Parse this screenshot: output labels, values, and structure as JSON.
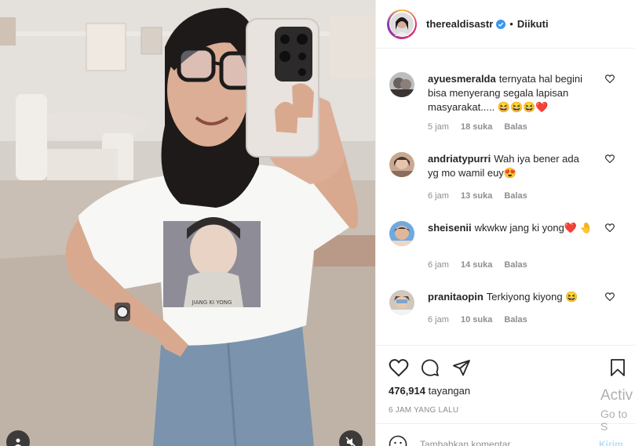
{
  "post": {
    "username": "therealdisastr",
    "follow_status": "Diikuti",
    "views_count": "476,914",
    "views_label": "tayangan",
    "time_ago": "6 JAM YANG LALU",
    "add_comment_placeholder": "Tambahkan komentar...",
    "post_label": "Kirim",
    "shirt_caption": "JIANG KI YONG"
  },
  "comments": [
    {
      "user": "ayuesmeralda",
      "text": "ternyata hal begini bisa menyerang segala lapisan masyarakat..... 😆😆😆❤️",
      "time": "5 jam",
      "likes": "18 suka",
      "reply": "Balas"
    },
    {
      "user": "andriatypurri",
      "text": "Wah iya bener ada yg mo wamil euy😍",
      "time": "6 jam",
      "likes": "13 suka",
      "reply": "Balas"
    },
    {
      "user": "sheisenii",
      "text": "wkwkw jang ki yong❤️ 🤚",
      "time": "6 jam",
      "likes": "14 suka",
      "reply": "Balas"
    },
    {
      "user": "pranitaopin",
      "text": "Terkiyong kiyong 😆",
      "time": "6 jam",
      "likes": "10 suka",
      "reply": "Balas"
    }
  ],
  "windows_watermark": {
    "line1": "Activ",
    "line2": "Go to S"
  },
  "icons": {
    "like": "heart-icon",
    "comment": "comment-icon",
    "share": "share-icon",
    "save": "bookmark-icon",
    "verified": "verified-badge-icon",
    "emoji": "smile-icon",
    "tag_people": "user-icon",
    "mute": "sound-off-icon"
  },
  "colors": {
    "verified_blue": "#3897f0",
    "heart_red": "#ed4956",
    "muted_text": "#8e8e8e",
    "post_button_disabled": "#b2dffc"
  }
}
